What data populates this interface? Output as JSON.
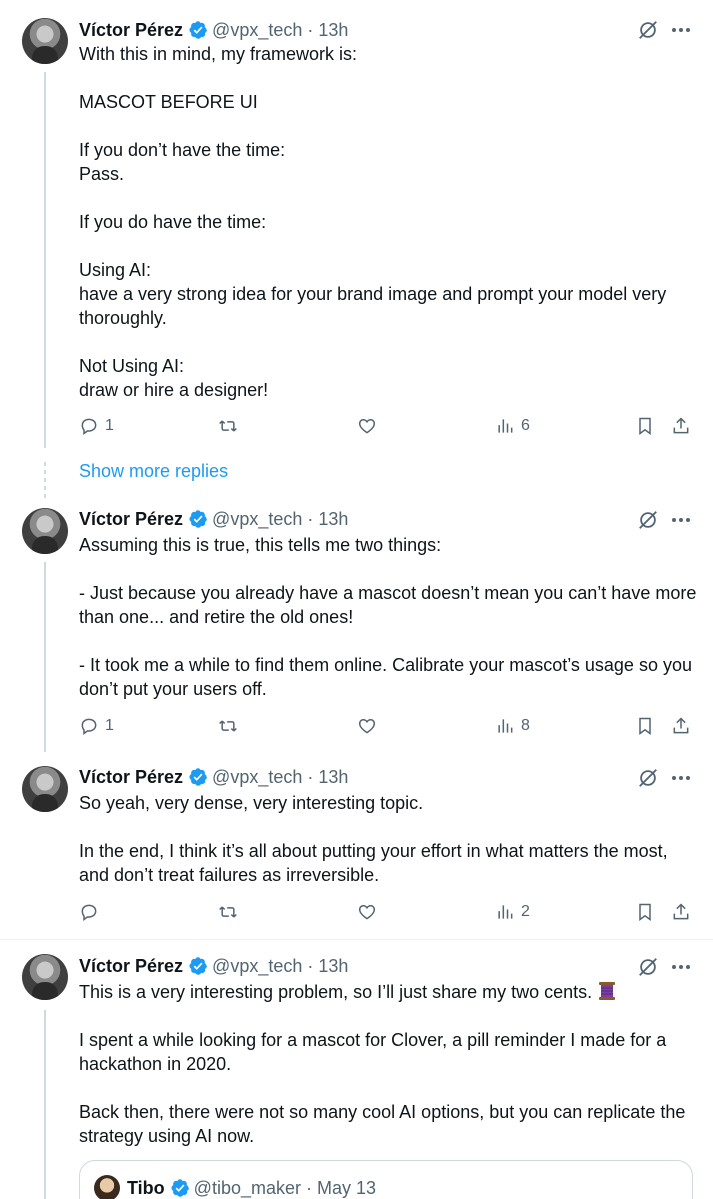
{
  "colors": {
    "accent": "#1d9bf0",
    "muted": "#536471",
    "text": "#0f1419",
    "border": "#cfd9de"
  },
  "icons": [
    "verified-badge-icon",
    "grok-icon",
    "more-icon",
    "reply-icon",
    "retweet-icon",
    "like-icon",
    "views-icon",
    "bookmark-icon",
    "share-icon",
    "spool-emoji-icon"
  ],
  "tweets": [
    {
      "name": "Víctor Pérez",
      "handle": "@vpx_tech",
      "sep": "·",
      "time": "13h",
      "text": "With this in mind, my framework is:\n\nMASCOT BEFORE UI\n\nIf you don’t have the time:\nPass.\n\nIf you do have the time:\n\nUsing AI:\nhave a very strong idea for your brand image and prompt your model very thoroughly.\n\nNot Using AI:\ndraw or hire a designer!",
      "replies": "1",
      "retweets": "",
      "likes": "",
      "views": "6"
    },
    {
      "name": "Víctor Pérez",
      "handle": "@vpx_tech",
      "sep": "·",
      "time": "13h",
      "text": "Assuming this is true, this tells me two things:\n\n- Just because you already have a mascot doesn’t mean you can’t have more than one... and retire the old ones!\n\n- It took me a while to find them online. Calibrate your mascot’s usage so you don’t put your users off.",
      "replies": "1",
      "retweets": "",
      "likes": "",
      "views": "8"
    },
    {
      "name": "Víctor Pérez",
      "handle": "@vpx_tech",
      "sep": "·",
      "time": "13h",
      "text": "So yeah, very dense, very interesting topic.\n\nIn the end, I think it’s all about putting your effort in what matters the most, and don’t treat failures as irreversible.",
      "replies": "",
      "retweets": "",
      "likes": "",
      "views": "2"
    },
    {
      "name": "Víctor Pérez",
      "handle": "@vpx_tech",
      "sep": "·",
      "time": "13h",
      "text_first": "This is a very interesting problem, so I’ll just share my two cents.",
      "text": "I spent a while looking for a mascot for Clover, a pill reminder I made for a hackathon in 2020.\n\nBack then, there were not so many cool AI options, but you can replicate the strategy using AI now."
    }
  ],
  "show_more_replies": "Show more replies",
  "quoted": {
    "name": "Tibo",
    "handle": "@tibo_maker",
    "sep": "·",
    "time": "May 13"
  }
}
